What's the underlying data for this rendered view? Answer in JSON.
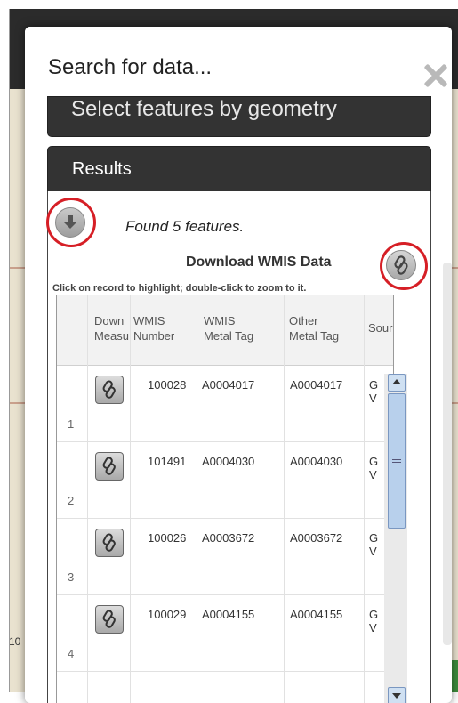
{
  "dialog": {
    "title": "Search for data...",
    "close_icon": "close-icon"
  },
  "sections": {
    "geometry_label": "Select features by geometry",
    "results_label": "Results"
  },
  "results": {
    "download_icon": "download-arrow-icon",
    "found_text": "Found 5 features.",
    "download_title": "Download WMIS Data",
    "link_icon": "link-icon",
    "hint": "Click on record to highlight; double-click to zoom to it."
  },
  "table": {
    "columns": [
      {
        "line1": "Down",
        "line2": "Measu"
      },
      {
        "line1": "WMIS",
        "line2": "Number"
      },
      {
        "line1": "WMIS",
        "line2": "Metal Tag"
      },
      {
        "line1": "Other",
        "line2": "Metal Tag"
      },
      {
        "line1": "Sour",
        "line2": ""
      }
    ],
    "rows": [
      {
        "num": "1",
        "wmis_number": "100028",
        "wmis_tag": "A0004017",
        "other_tag": "A0004017",
        "source1": "G",
        "source2": "V"
      },
      {
        "num": "2",
        "wmis_number": "101491",
        "wmis_tag": "A0004030",
        "other_tag": "A0004030",
        "source1": "G",
        "source2": "V"
      },
      {
        "num": "3",
        "wmis_number": "100026",
        "wmis_tag": "A0003672",
        "other_tag": "A0003672",
        "source1": "G",
        "source2": "V"
      },
      {
        "num": "4",
        "wmis_number": "100029",
        "wmis_tag": "A0004155",
        "other_tag": "A0004155",
        "source1": "G",
        "source2": "V"
      }
    ]
  },
  "background": {
    "map_label": "10"
  },
  "colors": {
    "header_dark": "#333333",
    "highlight_red": "#d61f26"
  }
}
